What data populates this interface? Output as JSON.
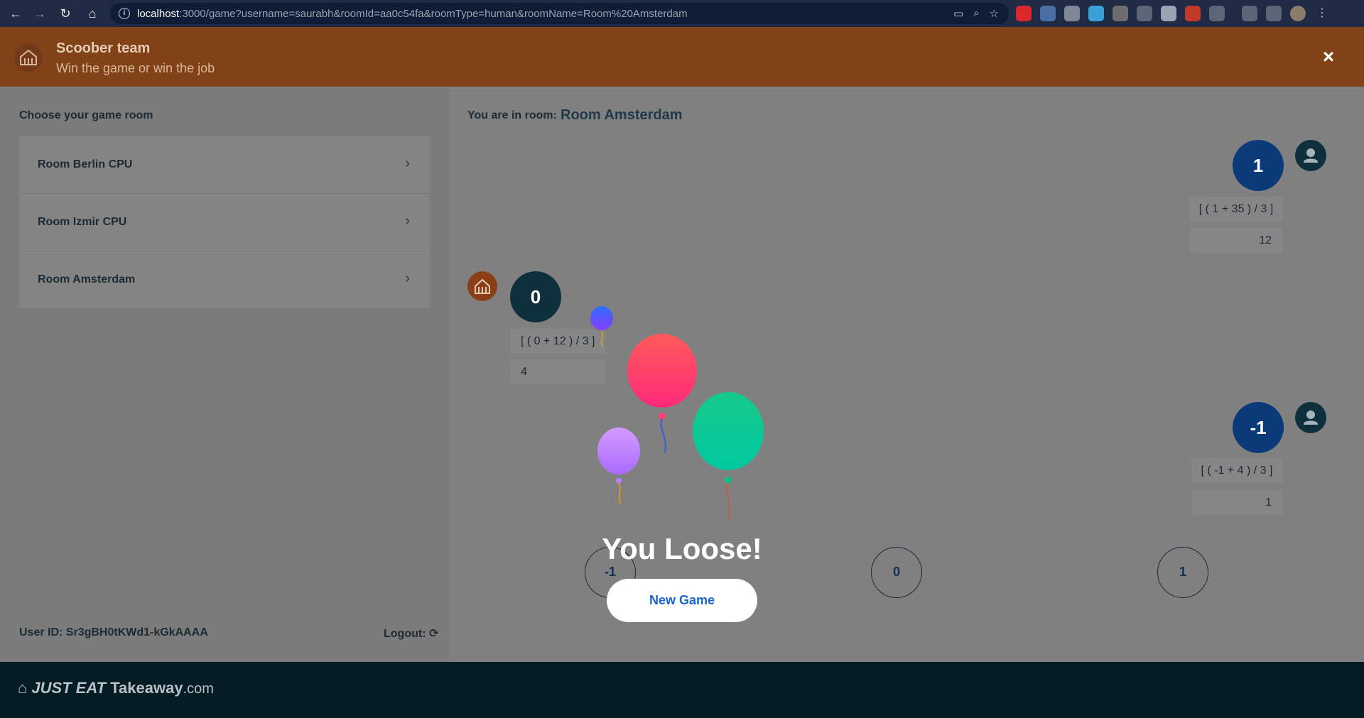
{
  "browser": {
    "url_host": "localhost",
    "url_rest": ":3000/game?username=saurabh&roomId=aa0c54fa&roomType=human&roomName=Room%20Amsterdam"
  },
  "header": {
    "title": "Scoober team",
    "subtitle": "Win the game or win the job",
    "close_icon": "×"
  },
  "sidebar": {
    "heading": "Choose your game room",
    "rooms": [
      {
        "label": "Room Berlin CPU"
      },
      {
        "label": "Room Izmir CPU"
      },
      {
        "label": "Room Amsterdam"
      }
    ],
    "user_id": "User ID: Sr3gBH0tKWd1-kGkAAAA",
    "logout": "Logout:"
  },
  "game": {
    "room_label": "You are in room:",
    "room_name": "Room Amsterdam",
    "left_player": {
      "score": "0",
      "calc": "[ ( 0 + 12 ) / 3 ]",
      "result": "4"
    },
    "top_player": {
      "score": "1",
      "calc": "[ ( 1 + 35 ) / 3 ]",
      "result": "12"
    },
    "bottom_player": {
      "score": "-1",
      "calc": "[ ( -1 + 4 ) / 3 ]",
      "result": "1"
    },
    "moves": [
      "-1",
      "0",
      "1"
    ],
    "result_text": "You Loose!",
    "new_game_label": "New Game"
  },
  "footer": {
    "brand_main": "JUST EAT",
    "brand_secondary": "Takeaway",
    "brand_suffix": ".com"
  },
  "colors": {
    "header_bg": "#824217",
    "footer_bg": "#051c25",
    "accent_blue": "#1766c9"
  }
}
